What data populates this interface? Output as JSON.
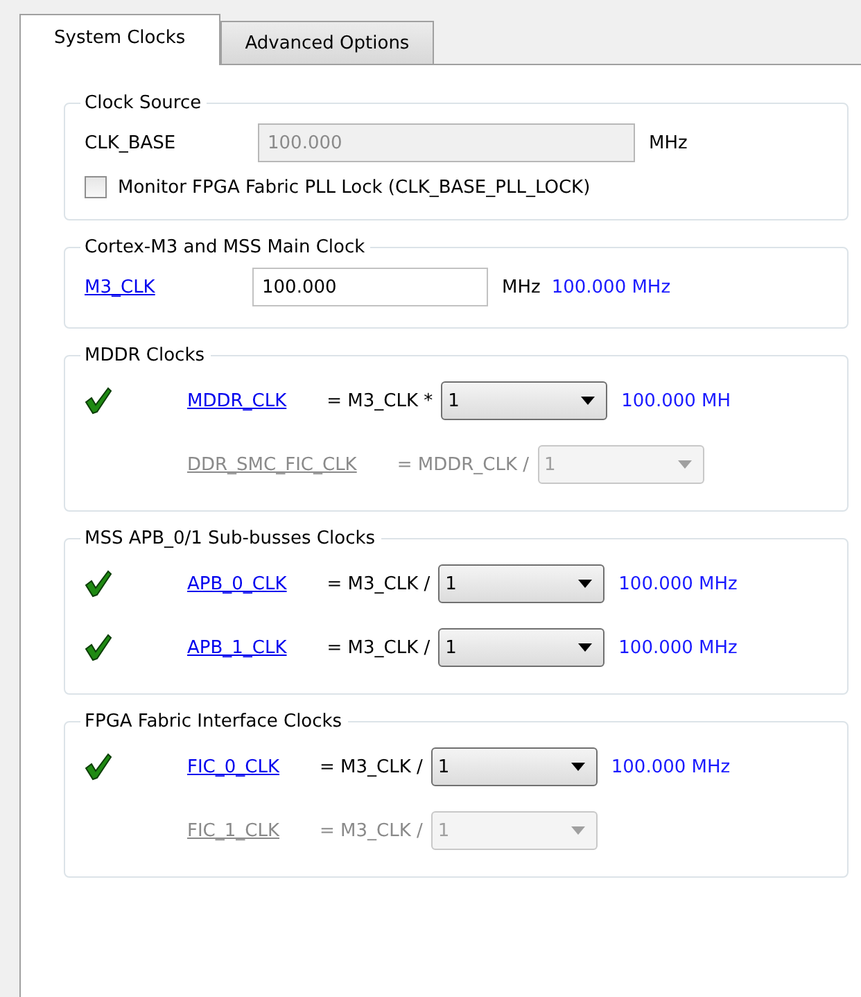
{
  "tabs": [
    {
      "label": "System Clocks",
      "selected": true
    },
    {
      "label": "Advanced Options",
      "selected": false
    }
  ],
  "groups": [
    {
      "title": "Clock Source",
      "rows": [
        {
          "kind": "field",
          "link": false,
          "label": "CLK_BASE",
          "value": "100.000",
          "unit": "MHz",
          "disabled": true
        },
        {
          "kind": "checkbox",
          "label": "Monitor FPGA Fabric PLL Lock (CLK_BASE_PLL_LOCK)",
          "checked": false
        }
      ]
    },
    {
      "title": "Cortex-M3 and MSS Main Clock",
      "rows": [
        {
          "kind": "field",
          "link": true,
          "label": "M3_CLK",
          "value": "100.000",
          "unit": "MHz",
          "readout": "100.000 MHz",
          "disabled": false
        }
      ]
    },
    {
      "title": "MDDR Clocks",
      "rows": [
        {
          "kind": "select",
          "ok": true,
          "label": "MDDR_CLK",
          "expr": "= M3_CLK *",
          "value": "1",
          "readout": "100.000 MH",
          "disabled": false
        },
        {
          "kind": "select",
          "ok": false,
          "label": "DDR_SMC_FIC_CLK",
          "expr": "= MDDR_CLK /",
          "value": "1",
          "disabled": true
        }
      ]
    },
    {
      "title": "MSS APB_0/1 Sub-busses Clocks",
      "rows": [
        {
          "kind": "select",
          "ok": true,
          "label": "APB_0_CLK",
          "expr": "= M3_CLK /",
          "value": "1",
          "readout": "100.000 MHz",
          "disabled": false
        },
        {
          "kind": "select",
          "ok": true,
          "label": "APB_1_CLK",
          "expr": "= M3_CLK /",
          "value": "1",
          "readout": "100.000 MHz",
          "disabled": false
        }
      ]
    },
    {
      "title": "FPGA Fabric Interface Clocks",
      "rows": [
        {
          "kind": "select",
          "ok": true,
          "label": "FIC_0_CLK",
          "expr": "= M3_CLK /",
          "value": "1",
          "readout": "100.000 MHz",
          "disabled": false
        },
        {
          "kind": "select",
          "ok": false,
          "label": "FIC_1_CLK",
          "expr": "= M3_CLK /",
          "value": "1",
          "disabled": true
        }
      ]
    }
  ]
}
